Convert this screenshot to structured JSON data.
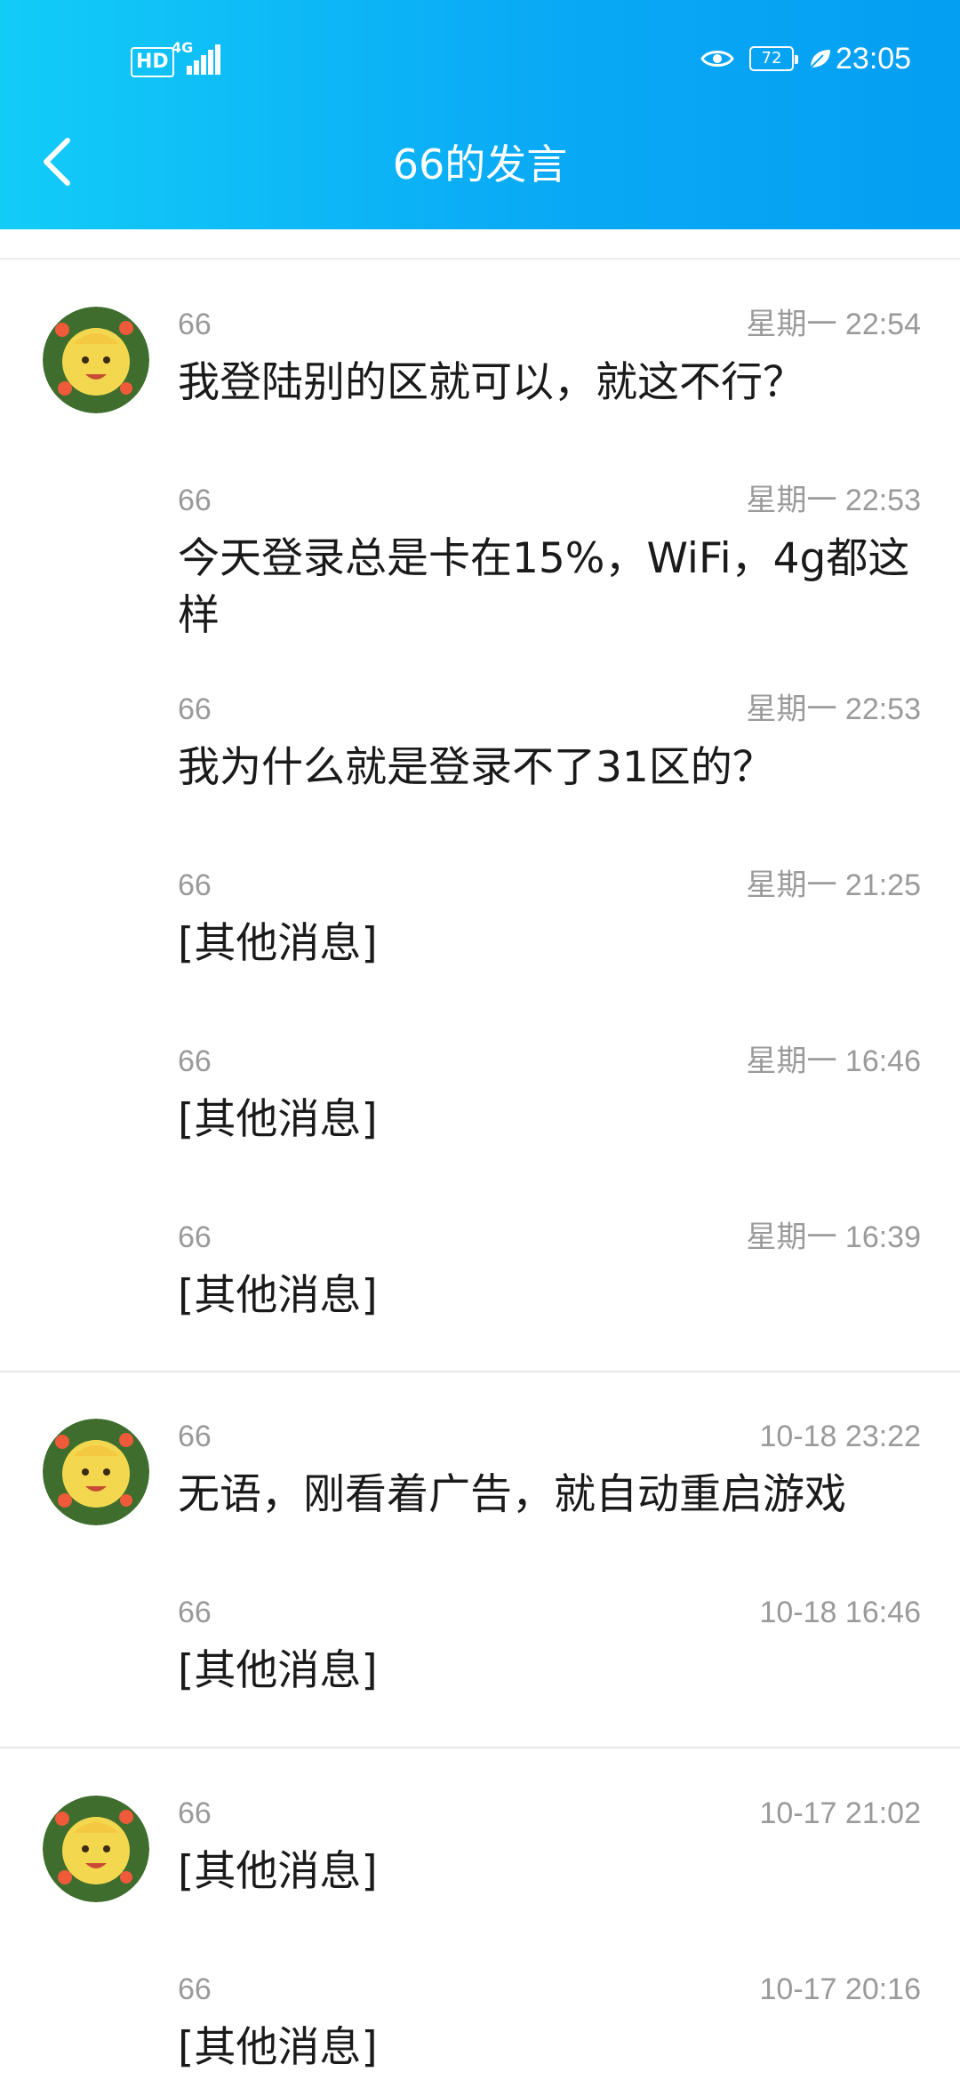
{
  "status_bar": {
    "hd": "HD",
    "network": "4G",
    "battery": "72",
    "time": "23:05"
  },
  "header": {
    "title": "66的发言"
  },
  "messages": [
    {
      "user": "66",
      "time": "星期一 22:54",
      "text": "我登陆别的区就可以，就这不行？"
    },
    {
      "user": "66",
      "time": "星期一 22:53",
      "text": "今天登录总是卡在15%，WiFi，4g都这样"
    },
    {
      "user": "66",
      "time": "星期一 22:53",
      "text": "我为什么就是登录不了31区的？"
    },
    {
      "user": "66",
      "time": "星期一 21:25",
      "text": "[其他消息]"
    },
    {
      "user": "66",
      "time": "星期一 16:46",
      "text": "[其他消息]"
    },
    {
      "user": "66",
      "time": "星期一 16:39",
      "text": "[其他消息]"
    },
    {
      "user": "66",
      "time": "10-18 23:22",
      "text": "无语，刚看着广告，就自动重启游戏"
    },
    {
      "user": "66",
      "time": "10-18 16:46",
      "text": "[其他消息]"
    },
    {
      "user": "66",
      "time": "10-17 21:02",
      "text": "[其他消息]"
    },
    {
      "user": "66",
      "time": "10-17 20:16",
      "text": "[其他消息]"
    }
  ],
  "icons": {
    "back": "chevron-left-icon",
    "eye": "eye-icon",
    "leaf": "leaf-icon",
    "signal": "signal-icon"
  },
  "colors": {
    "header_start": "#12ccf8",
    "header_end": "#049ef2",
    "meta_text": "#9a9a9a",
    "body_text": "#1a1a1a"
  }
}
